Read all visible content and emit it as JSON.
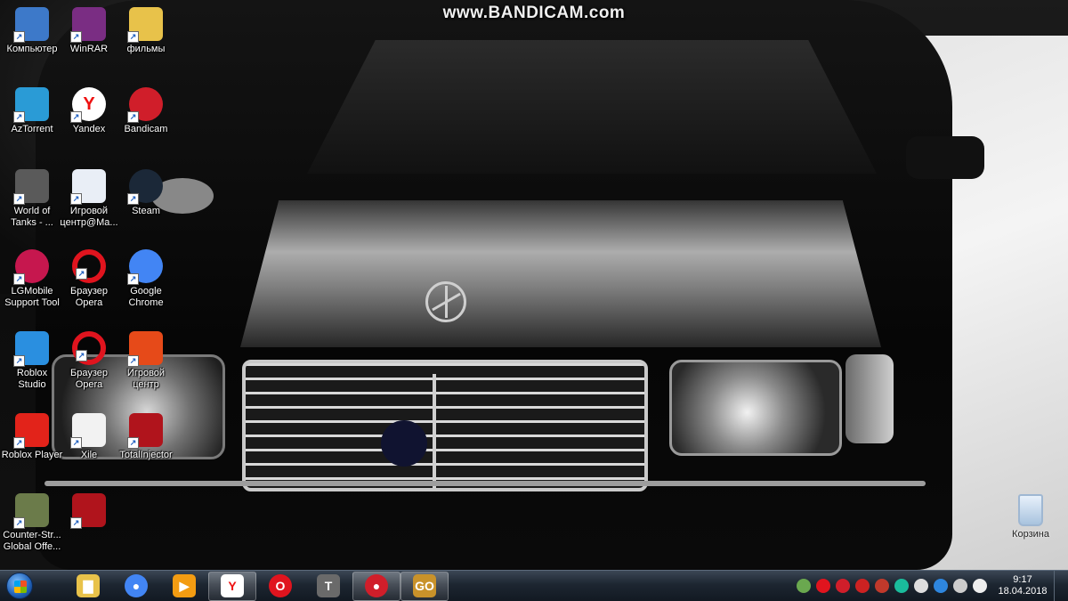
{
  "watermark": "www.BANDICAM.com",
  "desktop_icons": [
    {
      "label": "Компьютер",
      "icon": "computer-icon",
      "color": "#3d79c9"
    },
    {
      "label": "WinRAR",
      "icon": "winrar-icon",
      "color": "#7a2d83"
    },
    {
      "label": "фильмы",
      "icon": "folder-icon",
      "color": "#e8c24a"
    },
    {
      "label": "AzTorrent",
      "icon": "aztorrent-icon",
      "color": "#2a9bd6"
    },
    {
      "label": "Yandex",
      "icon": "yandex-icon",
      "color": "#ffffff"
    },
    {
      "label": "Bandicam",
      "icon": "bandicam-icon",
      "color": "#d01e2a"
    },
    {
      "label": "World of\nTanks - ...",
      "icon": "world-of-tanks-icon",
      "color": "#5a5a5a"
    },
    {
      "label": "Игровой\nцентр@Ma...",
      "icon": "game-center-mail-icon",
      "color": "#e9eef6"
    },
    {
      "label": "Steam",
      "icon": "steam-icon",
      "color": "#1b2838"
    },
    {
      "label": "LGMobile\nSupport Tool",
      "icon": "lg-mobile-icon",
      "color": "#c6174e"
    },
    {
      "label": "Браузер\nOpera",
      "icon": "opera-icon",
      "color": "#e0141e"
    },
    {
      "label": "Google\nChrome",
      "icon": "chrome-icon",
      "color": "#4285f4"
    },
    {
      "label": "Roblox\nStudio",
      "icon": "roblox-studio-icon",
      "color": "#2a8fe0"
    },
    {
      "label": "Браузер\nOpera",
      "icon": "opera-icon",
      "color": "#e0141e"
    },
    {
      "label": "Игровой\nцентр",
      "icon": "game-center-icon",
      "color": "#e64a19"
    },
    {
      "label": "Roblox Player",
      "icon": "roblox-player-icon",
      "color": "#e2231a"
    },
    {
      "label": "Xile",
      "icon": "file-icon",
      "color": "#f2f2f2"
    },
    {
      "label": "TotalInjector",
      "icon": "totalinjector-icon",
      "color": "#b0141c"
    },
    {
      "label": "Counter-Str...\nGlobal Offe...",
      "icon": "csgo-icon",
      "color": "#6b7b4a"
    },
    {
      "label": "",
      "icon": "injector-icon",
      "color": "#b0141c"
    }
  ],
  "recycle_bin": {
    "label": "Корзина",
    "icon": "recycle-bin-icon"
  },
  "taskbar": {
    "start": {
      "icon": "windows-start-icon"
    },
    "items": [
      {
        "icon": "explorer-folder-icon",
        "color": "#e8c24a",
        "glyph": "▇",
        "active": false
      },
      {
        "icon": "chrome-icon",
        "color": "#4285f4",
        "glyph": "●",
        "active": false
      },
      {
        "icon": "media-player-icon",
        "color": "#f39c12",
        "glyph": "▶",
        "active": false
      },
      {
        "icon": "yandex-icon",
        "color": "#ffffff",
        "glyph": "Y",
        "active": true
      },
      {
        "icon": "opera-icon",
        "color": "#e0141e",
        "glyph": "O",
        "active": false
      },
      {
        "icon": "world-of-tanks-icon",
        "color": "#6a6a6a",
        "glyph": "T",
        "active": false
      },
      {
        "icon": "bandicam-icon",
        "color": "#d01e2a",
        "glyph": "●",
        "active": true
      },
      {
        "icon": "csgo-icon",
        "color": "#c9922a",
        "glyph": "GO",
        "active": true
      }
    ],
    "tray": [
      {
        "icon": "network-cube-icon",
        "color": "#6aa84f"
      },
      {
        "icon": "opera-tray-icon",
        "color": "#e0141e"
      },
      {
        "icon": "bandicam-tray-icon",
        "color": "#d01e2a"
      },
      {
        "icon": "record-icon",
        "color": "#cc2222"
      },
      {
        "icon": "speed-icon",
        "color": "#c0392b"
      },
      {
        "icon": "antenna-icon",
        "color": "#1abc9c"
      },
      {
        "icon": "volume-icon",
        "color": "#dddddd"
      },
      {
        "icon": "e-icon",
        "color": "#2e86de"
      },
      {
        "icon": "monitor-icon",
        "color": "#cccccc"
      },
      {
        "icon": "flag-icon",
        "color": "#eeeeee"
      }
    ],
    "clock": {
      "time": "9:17",
      "date": "18.04.2018"
    }
  }
}
